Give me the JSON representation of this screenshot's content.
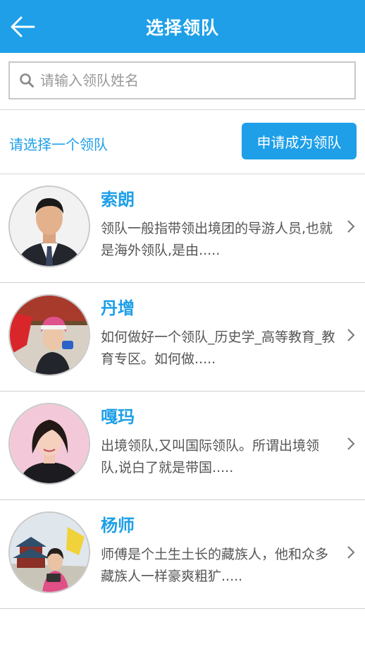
{
  "header": {
    "title": "选择领队"
  },
  "search": {
    "placeholder": "请输入领队姓名",
    "value": ""
  },
  "choose_hint": "请选择一个领队",
  "apply_button": "申请成为领队",
  "leaders": [
    {
      "name": "索朗",
      "desc": "领队一般指带领出境团的导游人员,也就是海外领队,是由....."
    },
    {
      "name": "丹增",
      "desc": "如何做好一个领队_历史学_高等教育_教育专区。如何做....."
    },
    {
      "name": "嘎玛",
      "desc": "出境领队,又叫国际领队。所谓出境领队,说白了就是带国....."
    },
    {
      "name": "杨师",
      "desc": "师傅是个土生土长的藏族人，他和众多藏族人一样豪爽粗犷....."
    }
  ],
  "colors": {
    "accent": "#1e9fe8",
    "divider": "#d0d0d0"
  }
}
